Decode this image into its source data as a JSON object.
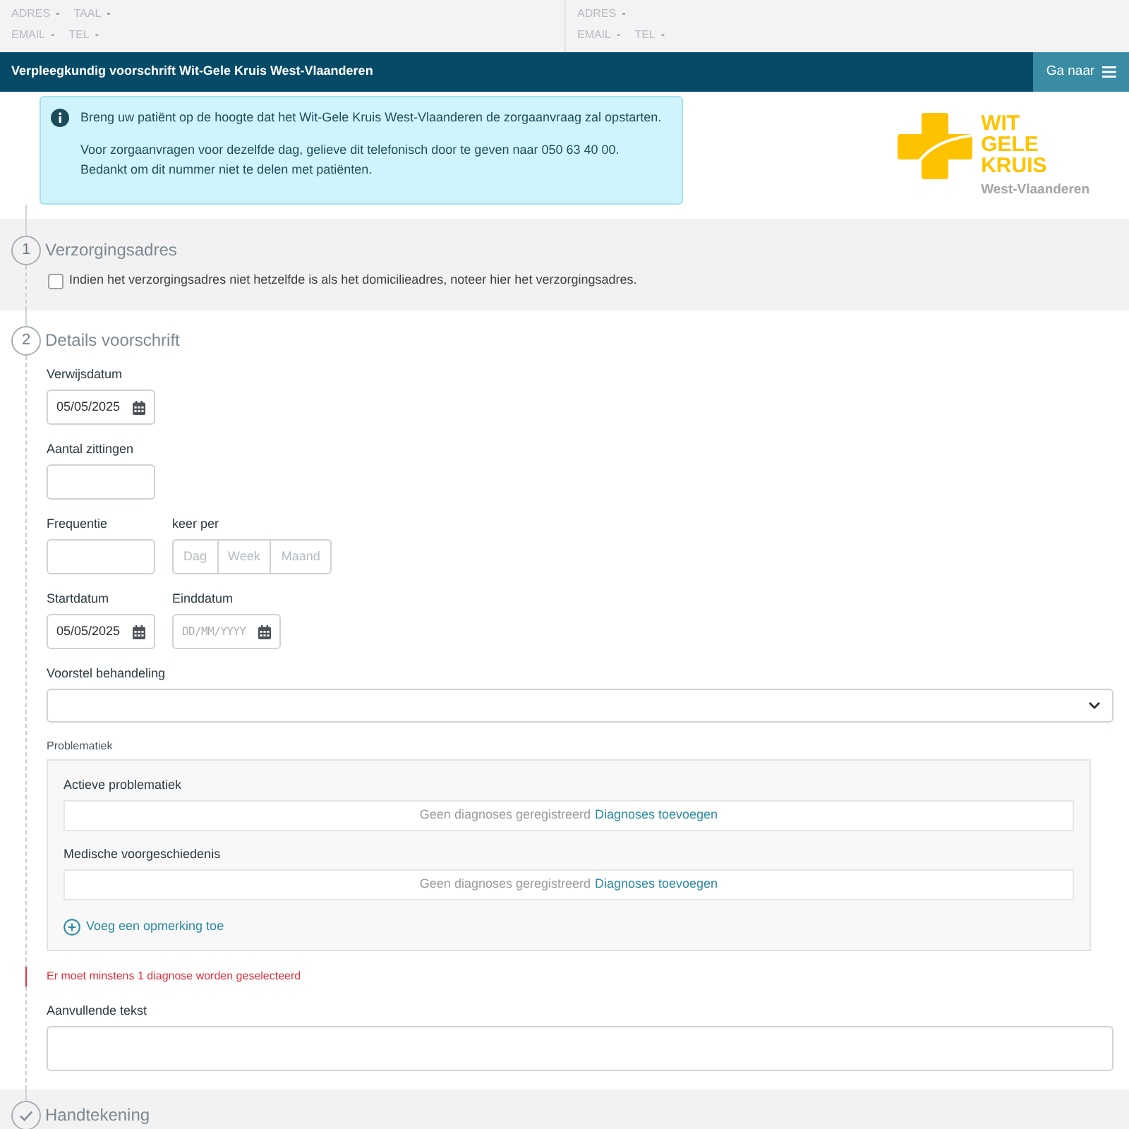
{
  "patient_header": {
    "columns": [
      {
        "rows": [
          [
            {
              "label": "ADRES",
              "value": "-"
            },
            {
              "label": "TAAL",
              "value": "-"
            }
          ],
          [
            {
              "label": "EMAIL",
              "value": "-"
            },
            {
              "label": "TEL",
              "value": "-"
            }
          ]
        ]
      },
      {
        "rows": [
          [
            {
              "label": "ADRES",
              "value": "-"
            }
          ],
          [
            {
              "label": "EMAIL",
              "value": "-"
            },
            {
              "label": "TEL",
              "value": "-"
            }
          ]
        ]
      }
    ]
  },
  "title_bar": {
    "title": "Verpleegkundig voorschrift Wit-Gele Kruis West-Vlaanderen",
    "button_label": "Ga naar"
  },
  "info_alert": {
    "paragraphs": [
      "Breng uw patiënt op de hoogte dat het Wit-Gele Kruis West-Vlaanderen de zorgaanvraag zal opstarten.",
      "Voor zorgaanvragen voor dezelfde dag, gelieve dit telefonisch door te geven naar 050 63 40 00.\nBedankt om dit nummer niet te delen met patiënten."
    ]
  },
  "logo": {
    "wordmark_lines": [
      "WIT",
      "GELE",
      "KRUIS"
    ],
    "region": "West-Vlaanderen"
  },
  "steps": [
    {
      "kind": "number",
      "number": "1",
      "title": "Verzorgingsadres",
      "active": false,
      "checkbox": {
        "label": "Indien het verzorgingsadres niet hetzelfde is als het domicilieadres, noteer hier het verzorgingsadres.",
        "checked": false
      }
    },
    {
      "kind": "number",
      "number": "2",
      "title": "Details voorschrift",
      "active": true,
      "fields": [
        {
          "kind": "date",
          "label": "Verwijsdatum",
          "value": "05/05/2025"
        },
        {
          "kind": "text",
          "label": "Aantal zittingen"
        },
        {
          "kind": "row",
          "items": [
            {
              "kind": "text",
              "label": "Frequentie"
            },
            {
              "kind": "segmented",
              "label": "keer per",
              "options": [
                {
                  "label": "Dag",
                  "selected": false
                },
                {
                  "label": "Week",
                  "selected": false
                },
                {
                  "label": "Maand",
                  "selected": false
                }
              ]
            }
          ]
        },
        {
          "kind": "row",
          "items": [
            {
              "kind": "date",
              "label": "Startdatum",
              "value": "05/05/2025"
            },
            {
              "kind": "date",
              "label": "Einddatum",
              "placeholder": "DD/MM/YYYY"
            }
          ]
        },
        {
          "kind": "select",
          "label": "Voorstel behandeling"
        },
        {
          "kind": "problems",
          "label": "Problematiek",
          "groups": [
            {
              "title": "Actieve problematiek",
              "empty_text": "Geen diagnoses geregistreerd",
              "link": "Diagnoses toevoegen"
            },
            {
              "title": "Medische voorgeschiedenis",
              "empty_text": "Geen diagnoses geregistreerd",
              "link": "Diagnoses toevoegen"
            }
          ],
          "add_note": "Voeg een opmerking toe"
        },
        {
          "kind": "error",
          "text": "Er moet minstens 1 diagnose worden geselecteerd"
        },
        {
          "kind": "textarea",
          "label": "Aanvullende tekst"
        }
      ]
    },
    {
      "kind": "check",
      "title": "Handtekening",
      "active": false
    }
  ]
}
